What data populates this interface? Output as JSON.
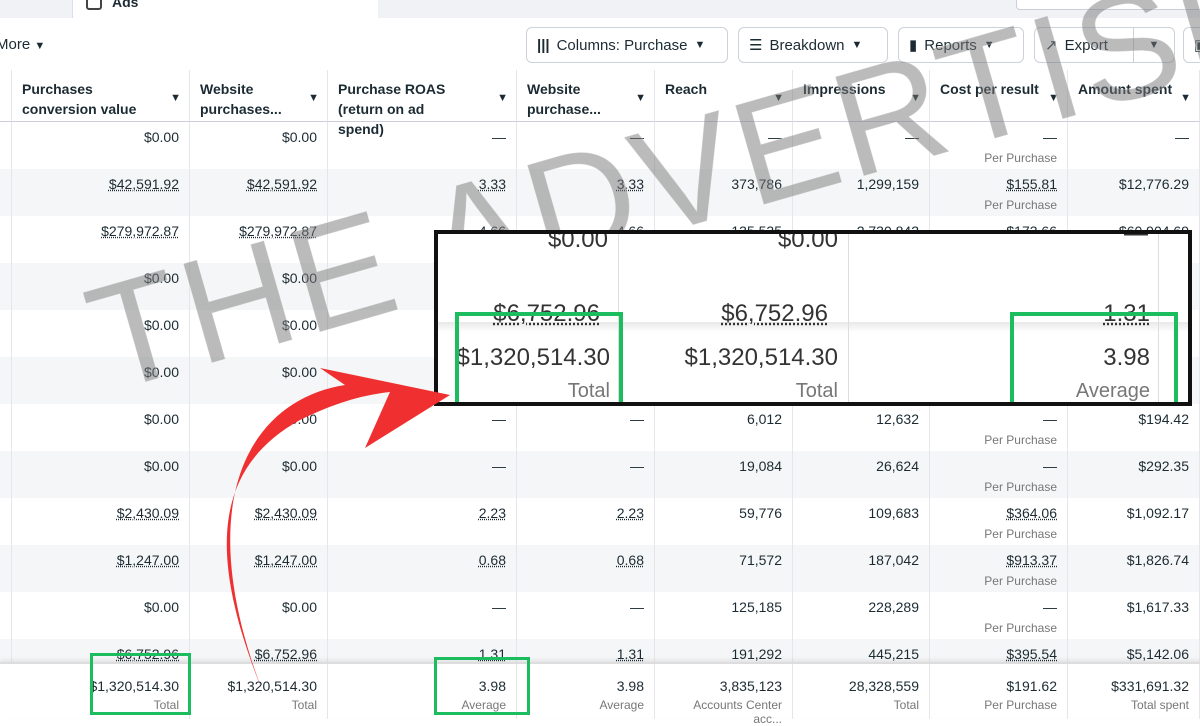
{
  "top": {
    "tab_label": "Ads"
  },
  "toolbar": {
    "more": "More",
    "columns": "Columns: Purchase",
    "breakdown": "Breakdown",
    "reports": "Reports",
    "export": "Export"
  },
  "columns": [
    "Purchases conversion value",
    "Website purchases...",
    "Purchase ROAS (return on ad spend)",
    "Website purchase...",
    "Reach",
    "Impressions",
    "Cost per result",
    "Amount spent"
  ],
  "rows": [
    [
      "$0.00",
      "$0.00",
      "—",
      "—",
      "—",
      "—",
      "—|Per Purchase",
      "—"
    ],
    [
      "$42,591.92",
      "$42,591.92",
      "3.33",
      "3.33",
      "373,786",
      "1,299,159",
      "$155.81|Per Purchase",
      "$12,776.29"
    ],
    [
      "$279,972.87",
      "$279,972.87",
      "4.66",
      "4.66",
      "135,535",
      "2,730,842",
      "$173.66",
      "$60,904.69"
    ],
    [
      "$0.00",
      "$0.00",
      "",
      "",
      "",
      "",
      "",
      ""
    ],
    [
      "$0.00",
      "$0.00",
      "",
      "",
      "",
      "",
      "",
      ""
    ],
    [
      "$0.00",
      "$0.00",
      "",
      "",
      "",
      "",
      "",
      ""
    ],
    [
      "$0.00",
      "$0.00",
      "—",
      "—",
      "6,012",
      "12,632",
      "—|Per Purchase",
      "$194.42"
    ],
    [
      "$0.00",
      "$0.00",
      "—",
      "—",
      "19,084",
      "26,624",
      "—|Per Purchase",
      "$292.35"
    ],
    [
      "$2,430.09",
      "$2,430.09",
      "2.23",
      "2.23",
      "59,776",
      "109,683",
      "$364.06|Per Purchase",
      "$1,092.17"
    ],
    [
      "$1,247.00",
      "$1,247.00",
      "0.68",
      "0.68",
      "71,572",
      "187,042",
      "$913.37|Per Purchase",
      "$1,826.74"
    ],
    [
      "$0.00",
      "$0.00",
      "—",
      "—",
      "125,185",
      "228,289",
      "—|Per Purchase",
      "$1,617.33"
    ],
    [
      "$6,752.96",
      "$6,752.96",
      "1.31",
      "1.31",
      "191,292",
      "445,215",
      "$395.54",
      "$5,142.06"
    ]
  ],
  "totals": [
    {
      "v": "$1,320,514.30",
      "s": "Total"
    },
    {
      "v": "$1,320,514.30",
      "s": "Total"
    },
    {
      "v": "3.98",
      "s": "Average"
    },
    {
      "v": "3.98",
      "s": "Average"
    },
    {
      "v": "3,835,123",
      "s": "Accounts Center acc..."
    },
    {
      "v": "28,328,559",
      "s": "Total"
    },
    {
      "v": "$191.62",
      "s": "Per Purchase"
    },
    {
      "v": "$331,691.32",
      "s": "Total spent"
    }
  ],
  "zoom": {
    "top1": "$0.00",
    "top2": "$0.00",
    "top3": "—",
    "mid1": "$6,752.96",
    "mid2": "$6,752.96",
    "mid3": "1.31",
    "val1": "$1,320,514.30",
    "val2": "$1,320,514.30",
    "val3": "3.98",
    "sub1": "Total",
    "sub2": "Total",
    "sub3": "Average"
  },
  "watermark": "THE ADVERTISERS",
  "colors": {
    "highlight": "#1cbd5e",
    "arrow": "#f03030"
  }
}
